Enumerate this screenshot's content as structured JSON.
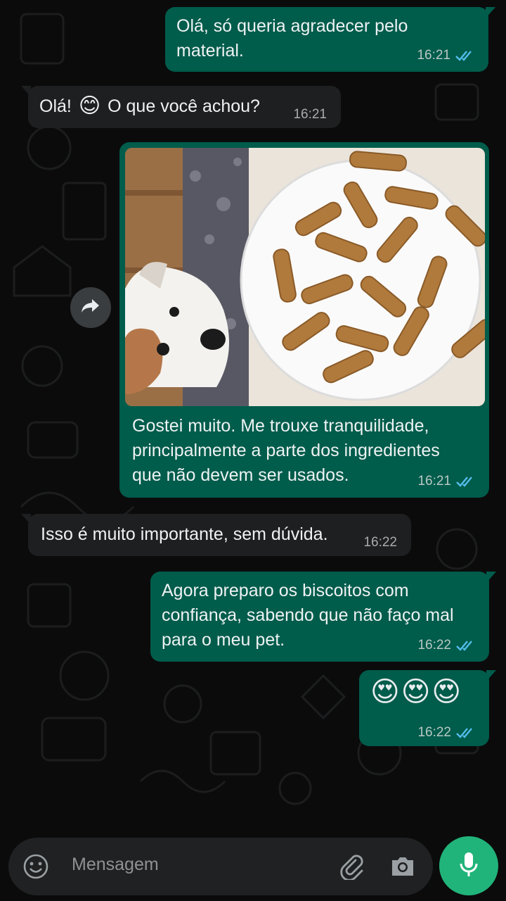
{
  "messages": [
    {
      "text": "Olá, só queria agradecer pelo\nmaterial.",
      "time": "16:21"
    },
    {
      "text_before": "Olá!",
      "emoji": "😊",
      "text_after": "O que você achou?",
      "time": "16:21"
    },
    {
      "caption": "Gostei muito. Me trouxe tranquilidade,\nprincipalmente a parte dos ingredientes\nque não devem ser usados.",
      "time": "16:21",
      "image": "dog-and-bone-biscuits-photo"
    },
    {
      "text": "Isso é muito importante, sem dúvida.",
      "time": "16:22"
    },
    {
      "text": "Agora preparo os biscoitos com\nconfiança, sabendo que não faço mal\npara o meu pet.",
      "time": "16:22"
    },
    {
      "emojis": "😍😍😍",
      "time": "16:22"
    }
  ],
  "composer": {
    "placeholder": "Mensagem"
  },
  "colors": {
    "outgoing": "#005c4b",
    "incoming": "#1e1f20",
    "mic": "#21b47a",
    "read_tick": "#53bdeb"
  }
}
